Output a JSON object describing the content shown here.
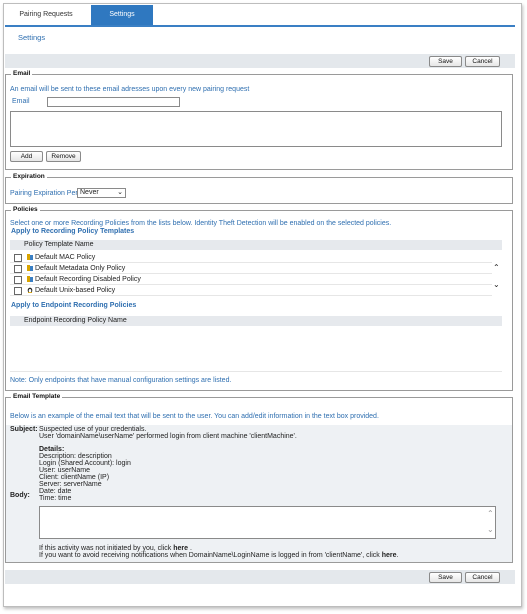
{
  "tabs": [
    {
      "label": "Pairing Requests"
    },
    {
      "label": "Settings"
    }
  ],
  "page_title": "Settings",
  "toolbar": {
    "save_label": "Save",
    "cancel_label": "Cancel"
  },
  "email": {
    "legend": "Email",
    "info": "An email will be sent to these email adresses upon every new pairing request",
    "field_label": "Email",
    "field_value": "",
    "add_label": "Add",
    "remove_label": "Remove"
  },
  "expiration": {
    "legend": "Expiration",
    "label": "Pairing Expiration Period",
    "selected": "Never"
  },
  "policies": {
    "legend": "Policies",
    "info": "Select one or more Recording Policies from the lists below. Identity Theft Detection will be enabled on the selected policies.",
    "recording_heading": "Apply to Recording Policy Templates",
    "recording_column": "Policy Template Name",
    "recording_rows": [
      {
        "name": "Default MAC Policy",
        "icon": "policy-icon"
      },
      {
        "name": "Default Metadata Only Policy",
        "icon": "policy-icon"
      },
      {
        "name": "Default Recording Disabled Policy",
        "icon": "policy-icon"
      },
      {
        "name": "Default Unix-based Policy",
        "icon": "linux-icon"
      }
    ],
    "endpoint_heading": "Apply to Endpoint Recording Policies",
    "endpoint_column": "Endpoint Recording Policy Name",
    "note": "Note: Only endpoints that have manual configuration settings are listed."
  },
  "template": {
    "legend": "Email Template",
    "info": "Below is an example of the email text that will be sent to the user. You can add/edit information in the text box provided.",
    "subject_label": "Subject:",
    "subject_text": "Suspected use of your credentials.",
    "subject_line2": "User 'domainName\\userName' performed login from client machine 'clientMachine'.",
    "details_title": "Details:",
    "details": [
      "Description: description",
      "Login (Shared Account): login",
      "User: userName",
      "Client: clientName (IP)",
      "Server: serverName",
      "Date: date",
      "Time: time"
    ],
    "body_label": "Body:",
    "body_value": "",
    "footer1_prefix": "If this activity was not initiated by you, click ",
    "footer1_link": "here",
    "footer1_suffix": " .",
    "footer2_prefix": "If you want to avoid receiving notifications when DomainName\\LoginName is logged in from 'clientName', click ",
    "footer2_link": "here",
    "footer2_suffix": "."
  }
}
